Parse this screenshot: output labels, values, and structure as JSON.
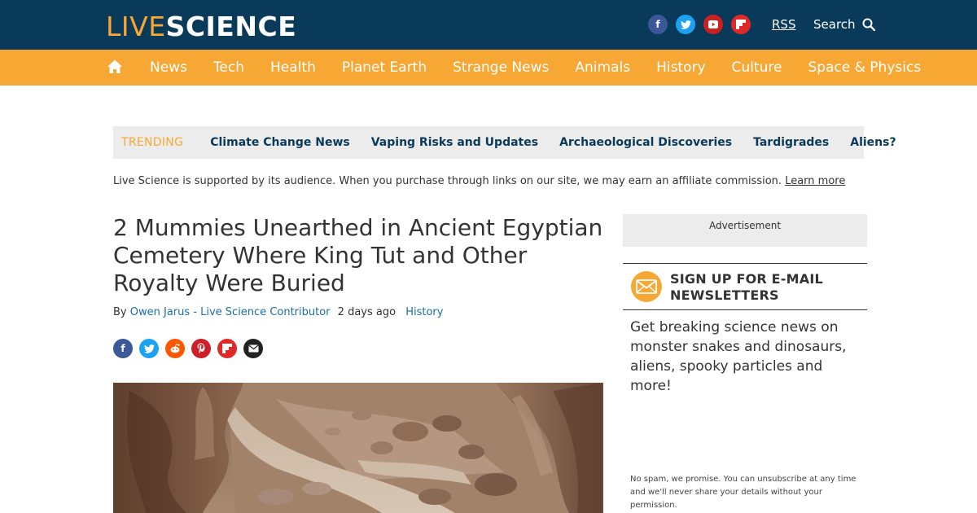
{
  "brand": {
    "logo_live": "LIVE",
    "logo_science": "SCIENCE"
  },
  "header": {
    "social": [
      {
        "icon": "facebook-icon",
        "glyph": "f"
      },
      {
        "icon": "twitter-icon",
        "glyph": "t"
      },
      {
        "icon": "youtube-icon",
        "glyph": "▶"
      },
      {
        "icon": "flipboard-icon",
        "glyph": "F"
      }
    ],
    "rss_label": "RSS",
    "search_label": "Search"
  },
  "nav": {
    "home_icon": "home-icon",
    "items": [
      "News",
      "Tech",
      "Health",
      "Planet Earth",
      "Strange News",
      "Animals",
      "History",
      "Culture",
      "Space & Physics"
    ]
  },
  "trending": {
    "label": "TRENDING",
    "items": [
      "Climate Change News",
      "Vaping Risks and Updates",
      "Archaeological Discoveries",
      "Tardigrades",
      "Aliens?"
    ]
  },
  "affiliate": {
    "text": "Live Science is supported by its audience. When you purchase through links on our site, we may earn an affiliate commission.",
    "link": "Learn more"
  },
  "article": {
    "title": "2 Mummies Unearthed in Ancient Egyptian Cemetery Where King Tut and Other Royalty Were Buried",
    "by": "By",
    "author": "Owen Jarus - Live Science Contributor",
    "time": "2 days ago",
    "category": "History",
    "share_icons": [
      "facebook-share-icon",
      "twitter-share-icon",
      "reddit-share-icon",
      "pinterest-share-icon",
      "flipboard-share-icon",
      "email-share-icon"
    ]
  },
  "sidebar": {
    "ad_label": "Advertisement",
    "newsletter_title": "SIGN UP FOR E-MAIL NEWSLETTERS",
    "newsletter_desc": "Get breaking science news on monster snakes and dinosaurs, aliens, spooky particles and more!",
    "newsletter_fine": "No spam, we promise. You can unsubscribe at any time and we'll never share your details without your permission."
  },
  "colors": {
    "header_bg": "#0a3a5a",
    "nav_bg": "#f7a733",
    "accent": "#f7a733",
    "link": "#1a6fa8"
  }
}
